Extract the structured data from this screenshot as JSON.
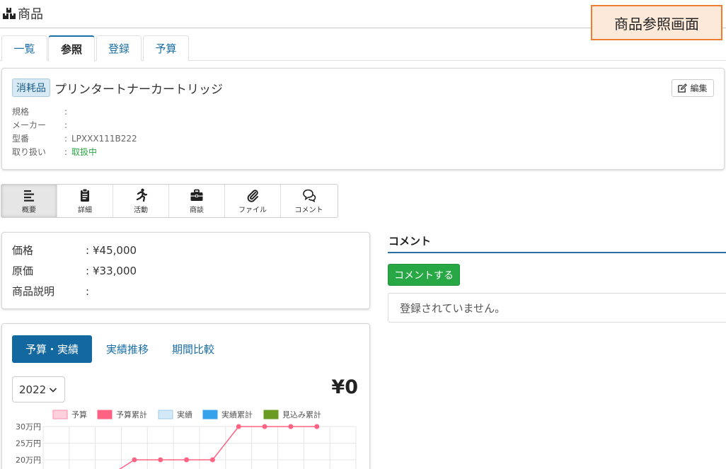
{
  "header": {
    "title": "商品",
    "callout": "商品参照画面"
  },
  "tabs": [
    {
      "label": "一覧"
    },
    {
      "label": "参照"
    },
    {
      "label": "登録"
    },
    {
      "label": "予算"
    }
  ],
  "product": {
    "category": "消耗品",
    "name": "プリンタートナーカートリッジ",
    "edit_label": "編集",
    "specs": [
      {
        "label": "規格",
        "colon": ":",
        "value": ""
      },
      {
        "label": "メーカー",
        "colon": ":",
        "value": ""
      },
      {
        "label": "型番",
        "colon": ":",
        "value": "LPXXX111B222"
      },
      {
        "label": "取り扱い",
        "colon": ":",
        "value": "取扱中"
      }
    ]
  },
  "toolbar": {
    "items": [
      {
        "label": "概要",
        "icon": "align-left-icon"
      },
      {
        "label": "詳細",
        "icon": "clipboard-icon"
      },
      {
        "label": "活動",
        "icon": "running-icon"
      },
      {
        "label": "商談",
        "icon": "briefcase-icon"
      },
      {
        "label": "ファイル",
        "icon": "paperclip-icon"
      },
      {
        "label": "コメント",
        "icon": "comments-icon"
      }
    ]
  },
  "prices": [
    {
      "label": "価格",
      "colon": ":",
      "value": "¥45,000"
    },
    {
      "label": "原価",
      "colon": ":",
      "value": "¥33,000"
    },
    {
      "label": "商品説明",
      "colon": ":",
      "value": ""
    }
  ],
  "comments": {
    "title": "コメント",
    "button": "コメントする",
    "empty": "登録されていません。"
  },
  "budget": {
    "tabs": [
      {
        "label": "予算・実績"
      },
      {
        "label": "実績推移"
      },
      {
        "label": "期間比較"
      }
    ],
    "year": "2022",
    "total": "¥0"
  },
  "colors": {
    "accent": "#1468a0",
    "success": "#28a745",
    "callout_border": "#ed7d31",
    "callout_bg": "#fde9d9"
  },
  "chart_data": {
    "type": "line",
    "title": "",
    "legend": [
      {
        "name": "予算",
        "color": "#ffd1dc",
        "border": "#ff8fab"
      },
      {
        "name": "予算累計",
        "color": "#ff6384",
        "border": "#ff6384"
      },
      {
        "name": "実績",
        "color": "#d3e9f8",
        "border": "#9ccbec"
      },
      {
        "name": "実績累計",
        "color": "#36a2eb",
        "border": "#36a2eb"
      },
      {
        "name": "見込み累計",
        "color": "#6b9a22",
        "border": "#6b9a22"
      }
    ],
    "yticks": [
      "30万円",
      "25万円",
      "20万円"
    ],
    "ylim": [
      0,
      300000
    ],
    "series": [
      {
        "name": "予算累計",
        "x": [
          3,
          4,
          5,
          6,
          7,
          8,
          9,
          10,
          11
        ],
        "values": [
          150000,
          200000,
          200000,
          200000,
          200000,
          300000,
          300000,
          300000,
          300000
        ]
      }
    ]
  }
}
